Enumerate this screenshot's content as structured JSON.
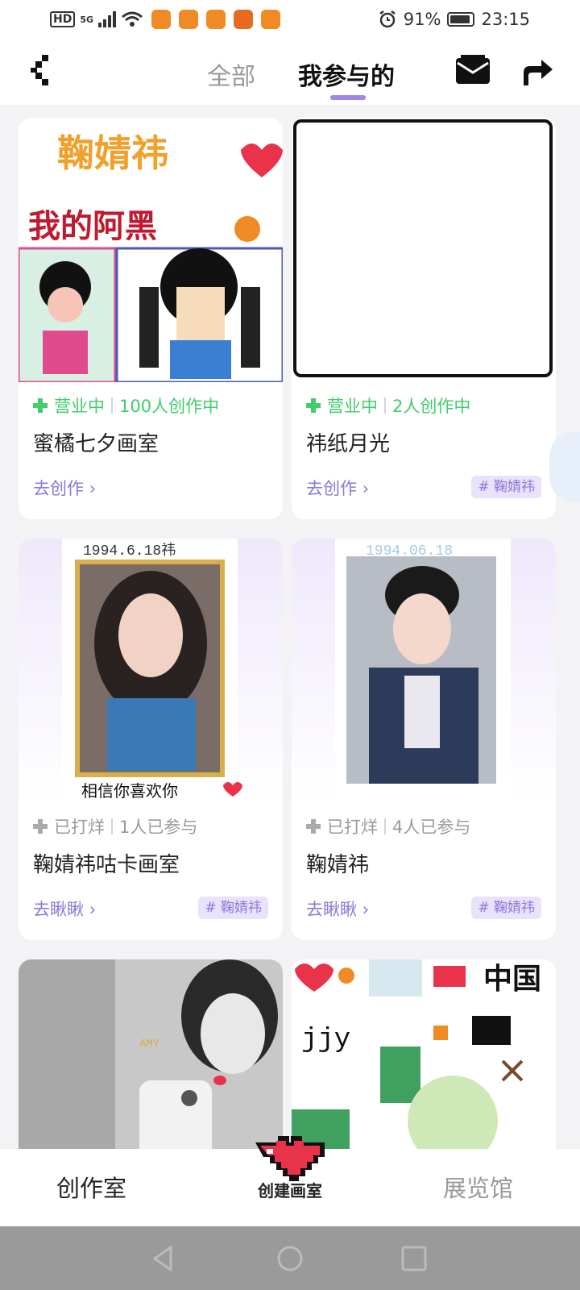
{
  "status_bar": {
    "hd": "HD",
    "network": "5G",
    "battery": "91%",
    "time": "23:15"
  },
  "header": {
    "tabs": [
      {
        "label": "全部",
        "active": false
      },
      {
        "label": "我参与的",
        "active": true
      }
    ]
  },
  "cards": [
    {
      "status": "营业中",
      "count": "100人创作中",
      "title": "蜜橘七夕画室",
      "action": "去创作",
      "tag": null,
      "image_text": [
        "鞠婧祎",
        "我的阿黑"
      ]
    },
    {
      "status": "营业中",
      "count": "2人创作中",
      "title": "祎纸月光",
      "action": "去创作",
      "tag": "鞠婧祎"
    },
    {
      "status": "已打烊",
      "count": "1人已参与",
      "title": "鞠婧祎咕卡画室",
      "action": "去瞅瞅",
      "tag": "鞠婧祎",
      "image_text": [
        "1994.6.18祎",
        "相信你喜欢你"
      ]
    },
    {
      "status": "已打烊",
      "count": "4人已参与",
      "title": "鞠婧祎",
      "action": "去瞅瞅",
      "tag": "鞠婧祎",
      "image_text": [
        "1994.06.18"
      ]
    },
    {
      "image_text": [
        "AMY"
      ]
    },
    {
      "image_text": [
        "中国",
        "jjy"
      ]
    }
  ],
  "bottom_nav": {
    "studio": "创作室",
    "create": "创建画室",
    "gallery": "展览馆"
  },
  "colors": {
    "accent": "#9f86e8",
    "open_green": "#3fce6a",
    "tag_bg": "#e9e2fb",
    "link": "#8d78d8"
  }
}
